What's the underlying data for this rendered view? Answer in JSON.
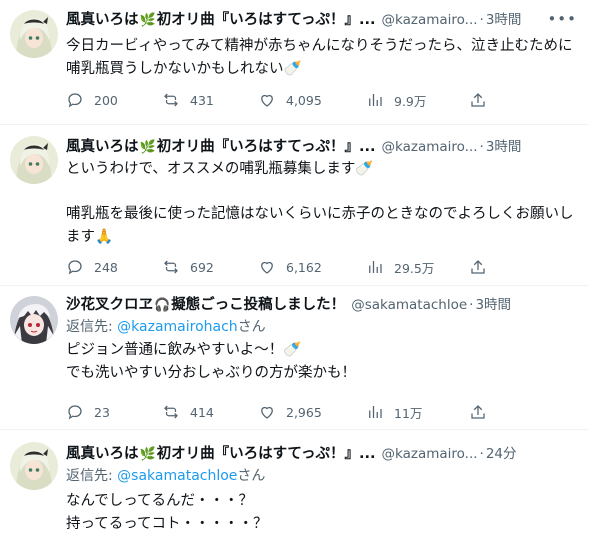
{
  "tweets": [
    {
      "name": "風真いろは",
      "name_suffix": "初オリ曲『いろはすてっぷ！』...",
      "name_emoji": "🌿",
      "handle": "@kazamairo...",
      "time": "3時間",
      "reply_prefix": "",
      "reply_mention": "",
      "reply_suffix": "",
      "text": "今日カービィやってみて精神が赤ちゃんになりそうだったら、泣き止むために哺乳瓶買うしかないかもしれない🍼",
      "replies": "200",
      "retweets": "431",
      "likes": "4,095",
      "views": "9.9万"
    },
    {
      "name": "風真いろは",
      "name_suffix": "初オリ曲『いろはすてっぷ！』...",
      "name_emoji": "🌿",
      "handle": "@kazamairo...",
      "time": "3時間",
      "reply_prefix": "",
      "reply_mention": "",
      "reply_suffix": "",
      "text": "というわけで、オススメの哺乳瓶募集します🍼\n\n哺乳瓶を最後に使った記憶はないくらいに赤子のときなのでよろしくお願いします🙏",
      "replies": "248",
      "retweets": "692",
      "likes": "6,162",
      "views": "29.5万"
    },
    {
      "name": "沙花叉クロヱ",
      "name_suffix": "擬態ごっこ投稿しました！",
      "name_emoji": "🎧",
      "handle": "@sakamatachloe",
      "time": "3時間",
      "reply_prefix": "返信先: ",
      "reply_mention": "@kazamairohach",
      "reply_suffix": "さん",
      "text": "ピジョン普通に飲みやすいよ〜！🍼\nでも洗いやすい分おしゃぶりの方が楽かも！",
      "replies": "23",
      "retweets": "414",
      "likes": "2,965",
      "views": "11万"
    },
    {
      "name": "風真いろは",
      "name_suffix": "初オリ曲『いろはすてっぷ！』...",
      "name_emoji": "🌿",
      "handle": "@kazamairo...",
      "time": "24分",
      "reply_prefix": "返信先: ",
      "reply_mention": "@sakamatachloe",
      "reply_suffix": "さん",
      "text": "なんでしってるんだ・・・？\n持ってるってコト・・・・・？",
      "replies": "",
      "retweets": "",
      "likes": "",
      "views": ""
    }
  ],
  "icons": {
    "more": "more-horizontal-icon",
    "reply": "reply-icon",
    "retweet": "retweet-icon",
    "like": "heart-icon",
    "views": "views-bar-chart-icon",
    "share": "share-icon"
  },
  "colors": {
    "text": "#0f1419",
    "secondary": "#536471",
    "link": "#1d9bf0",
    "divider": "#eff3f4",
    "background": "#ffffff"
  }
}
